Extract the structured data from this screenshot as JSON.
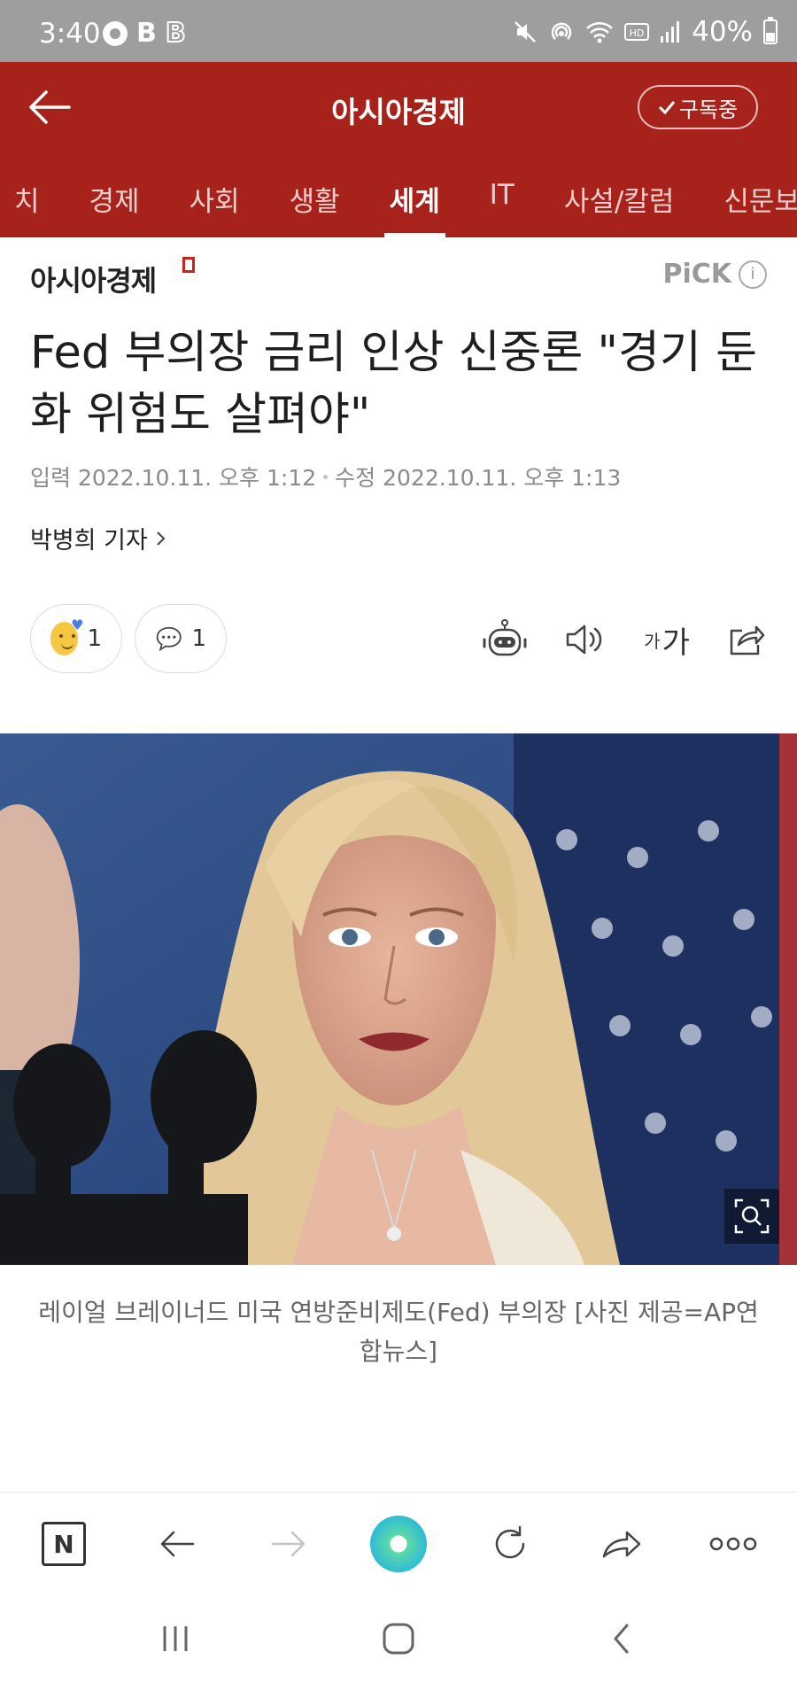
{
  "status_bar": {
    "time": "3:40",
    "battery": "40%"
  },
  "header": {
    "title": "아시아경제",
    "subscribe_label": "구독중"
  },
  "nav": {
    "items": [
      "치",
      "경제",
      "사회",
      "생활",
      "세계",
      "IT",
      "사설/칼럼",
      "신문보기"
    ],
    "active": "세계"
  },
  "article": {
    "press_name": "아시아경제",
    "pick_label": "PiCK",
    "headline": "Fed 부의장 금리 인상 신중론 \"경기 둔화 위험도 살펴야\"",
    "input_label": "입력",
    "input_time": "2022.10.11. 오후 1:12",
    "edit_label": "수정",
    "edit_time": "2022.10.11. 오후 1:13",
    "reporter": "박병희 기자",
    "reaction_count": "1",
    "comment_count": "1",
    "font_tool_small": "가",
    "font_tool_large": "가",
    "caption": "레이얼 브레이너드 미국 연방준비제도(Fed) 부의장 [사진 제공=AP연합뉴스]"
  },
  "browser_bar": {
    "n_label": "N"
  },
  "colors": {
    "brand_red": "#a8221c",
    "status_gray": "#9e9e9e"
  }
}
